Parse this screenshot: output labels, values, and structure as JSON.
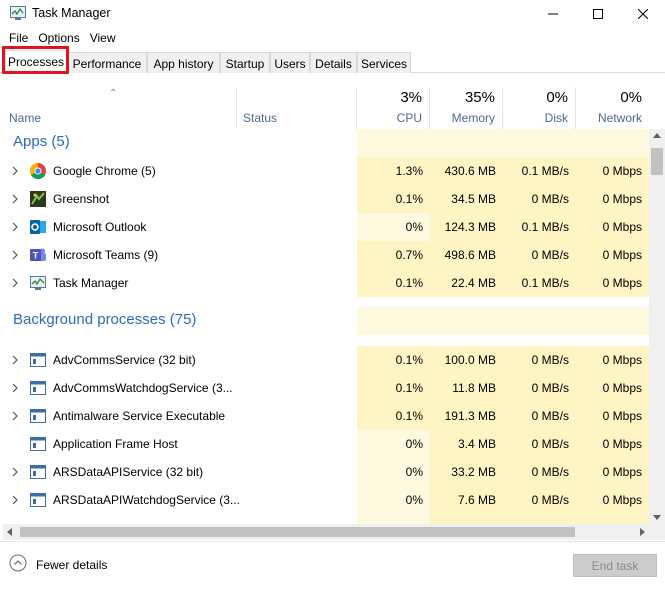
{
  "window": {
    "title": "Task Manager"
  },
  "menu": [
    "File",
    "Options",
    "View"
  ],
  "tabs": [
    "Processes",
    "Performance",
    "App history",
    "Startup",
    "Users",
    "Details",
    "Services"
  ],
  "active_tab": "Processes",
  "columns": {
    "name": "Name",
    "status": "Status",
    "cpu": {
      "pct": "3%",
      "label": "CPU"
    },
    "memory": {
      "pct": "35%",
      "label": "Memory"
    },
    "disk": {
      "pct": "0%",
      "label": "Disk"
    },
    "network": {
      "pct": "0%",
      "label": "Network"
    }
  },
  "groups": {
    "apps": "Apps (5)",
    "background": "Background processes (75)"
  },
  "apps": [
    {
      "name": "Google Chrome (5)",
      "cpu": "1.3%",
      "mem": "430.6 MB",
      "disk": "0.1 MB/s",
      "net": "0 Mbps",
      "icon": "chrome-icon"
    },
    {
      "name": "Greenshot",
      "cpu": "0.1%",
      "mem": "34.5 MB",
      "disk": "0 MB/s",
      "net": "0 Mbps",
      "icon": "greenshot-icon"
    },
    {
      "name": "Microsoft Outlook",
      "cpu": "0%",
      "mem": "124.3 MB",
      "disk": "0.1 MB/s",
      "net": "0 Mbps",
      "icon": "outlook-icon"
    },
    {
      "name": "Microsoft Teams (9)",
      "cpu": "0.7%",
      "mem": "498.6 MB",
      "disk": "0 MB/s",
      "net": "0 Mbps",
      "icon": "teams-icon"
    },
    {
      "name": "Task Manager",
      "cpu": "0.1%",
      "mem": "22.4 MB",
      "disk": "0.1 MB/s",
      "net": "0 Mbps",
      "icon": "task-manager-icon"
    }
  ],
  "background": [
    {
      "name": "AdvCommsService (32 bit)",
      "cpu": "0.1%",
      "mem": "100.0 MB",
      "disk": "0 MB/s",
      "net": "0 Mbps",
      "expand": true
    },
    {
      "name": "AdvCommsWatchdogService (3...",
      "cpu": "0.1%",
      "mem": "11.8 MB",
      "disk": "0 MB/s",
      "net": "0 Mbps",
      "expand": true
    },
    {
      "name": "Antimalware Service Executable",
      "cpu": "0.1%",
      "mem": "191.3 MB",
      "disk": "0 MB/s",
      "net": "0 Mbps",
      "expand": true
    },
    {
      "name": "Application Frame Host",
      "cpu": "0%",
      "mem": "3.4 MB",
      "disk": "0 MB/s",
      "net": "0 Mbps",
      "expand": false
    },
    {
      "name": "ARSDataAPIService (32 bit)",
      "cpu": "0%",
      "mem": "33.2 MB",
      "disk": "0 MB/s",
      "net": "0 Mbps",
      "expand": true
    },
    {
      "name": "ARSDataAPIWatchdogService (3...",
      "cpu": "0%",
      "mem": "7.6 MB",
      "disk": "0 MB/s",
      "net": "0 Mbps",
      "expand": true
    }
  ],
  "footer": {
    "fewer_details": "Fewer details",
    "end_task": "End task"
  },
  "colors": {
    "highlight": "#e0141e",
    "group_text": "#2c6bbd",
    "heat_light": "#fff4c4",
    "heat_pale": "#fff9e0"
  }
}
